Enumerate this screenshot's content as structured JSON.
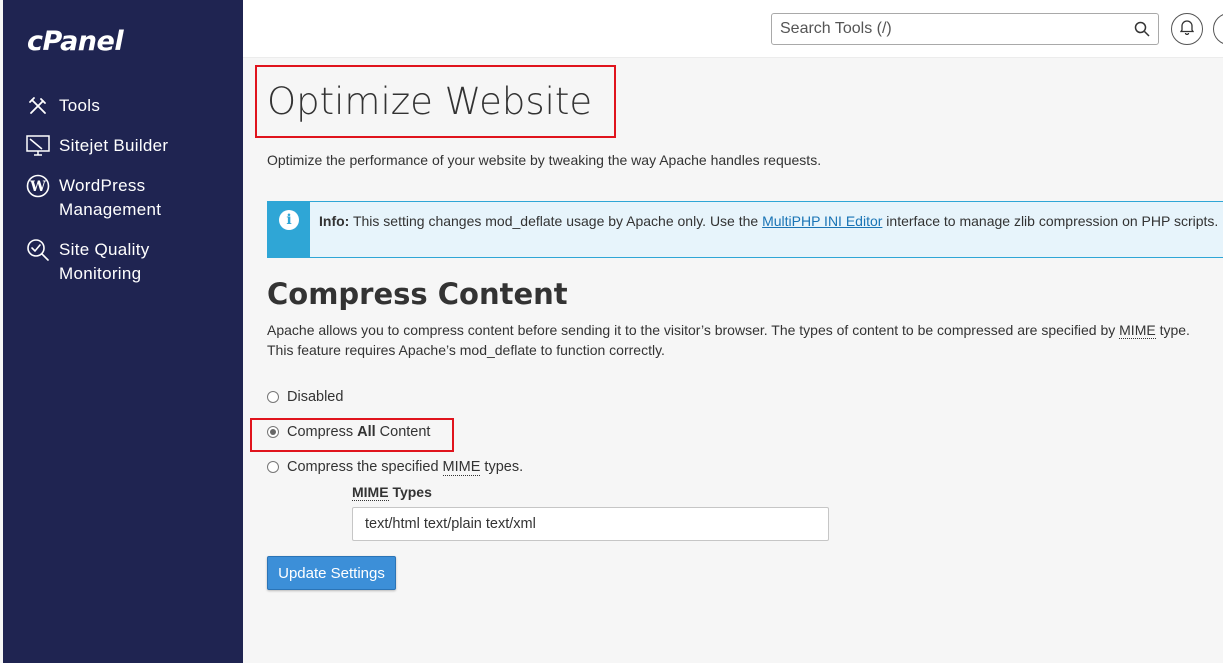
{
  "sidebar": {
    "brand": "cPanel",
    "items": [
      {
        "label": "Tools",
        "icon": "tools-icon"
      },
      {
        "label": "Sitejet Builder",
        "icon": "monitor-icon"
      },
      {
        "label": "WordPress",
        "label2": "Management",
        "icon": "wordpress-icon"
      },
      {
        "label": "Site Quality",
        "label2": "Monitoring",
        "icon": "search-check-icon"
      }
    ]
  },
  "header": {
    "search_placeholder": "Search Tools (/)"
  },
  "page": {
    "title": "Optimize Website",
    "description": "Optimize the performance of your website by tweaking the way Apache handles requests."
  },
  "info": {
    "label": "Info:",
    "text_before": " This setting changes mod_deflate usage by Apache only. Use the ",
    "link": "MultiPHP INI Editor",
    "text_after": " interface to manage zlib compression on PHP scripts."
  },
  "compress": {
    "heading": "Compress Content",
    "para_line1_before": "Apache allows you to compress content before sending it to the visitor’s browser. The types of content to be compressed are specified by ",
    "para_line1_abbr": "MIME",
    "para_line1_after": " type.",
    "para_line2": "This feature requires Apache’s mod_deflate to function correctly.",
    "options": {
      "disabled": "Disabled",
      "all_before": "Compress ",
      "all_bold": "All",
      "all_after": " Content",
      "specified_before": "Compress the specified ",
      "specified_abbr": "MIME",
      "specified_after": " types."
    },
    "selected": "all",
    "mime_label_abbr": "MIME",
    "mime_label_after": " Types",
    "mime_value": "text/html text/plain text/xml",
    "button": "Update Settings"
  },
  "colors": {
    "sidebar": "#1f2451",
    "accent": "#3c8fd8",
    "info": "#2fa6d6",
    "highlight": "#e0141d"
  }
}
